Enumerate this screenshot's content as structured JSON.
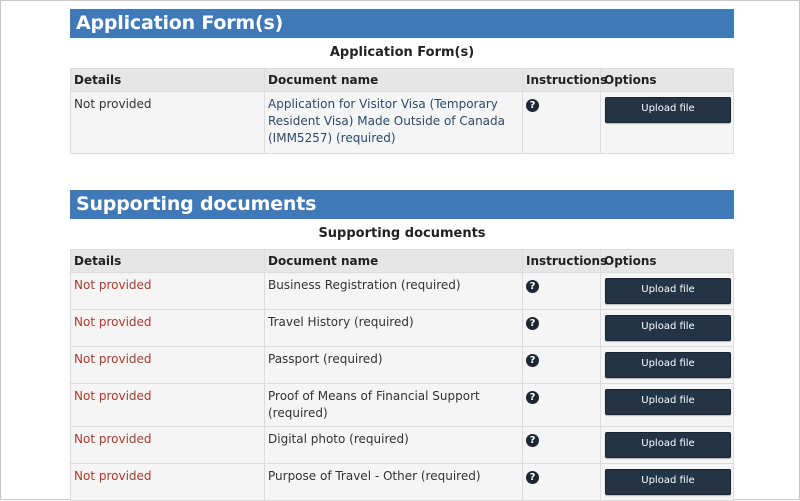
{
  "application_section": {
    "banner_title": "Application Form(s)",
    "caption": "Application Form(s)",
    "headers": {
      "details": "Details",
      "document_name": "Document name",
      "instructions": "Instructions",
      "options": "Options"
    },
    "rows": [
      {
        "details": "Not provided",
        "document_name": "Application for Visitor Visa (Temporary Resident Visa) Made Outside of Canada (IMM5257)  (required)",
        "instructions_icon": "question-circle-icon",
        "button_label": "Upload file"
      }
    ]
  },
  "supporting_section": {
    "banner_title": "Supporting documents",
    "caption": "Supporting documents",
    "headers": {
      "details": "Details",
      "document_name": "Document name",
      "instructions": "Instructions",
      "options": "Options"
    },
    "rows": [
      {
        "details": "Not provided",
        "document_name": "Business Registration  (required)",
        "instructions_icon": "question-circle-icon",
        "button_label": "Upload file"
      },
      {
        "details": "Not provided",
        "document_name": "Travel History  (required)",
        "instructions_icon": "question-circle-icon",
        "button_label": "Upload file"
      },
      {
        "details": "Not provided",
        "document_name": "Passport  (required)",
        "instructions_icon": "question-circle-icon",
        "button_label": "Upload file"
      },
      {
        "details": "Not provided",
        "document_name": "Proof of Means of Financial Support  (required)",
        "instructions_icon": "question-circle-icon",
        "button_label": "Upload file"
      },
      {
        "details": "Not provided",
        "document_name": "Digital photo  (required)",
        "instructions_icon": "question-circle-icon",
        "button_label": "Upload file"
      },
      {
        "details": "Not provided",
        "document_name": "Purpose of Travel - Other  (required)",
        "instructions_icon": "question-circle-icon",
        "button_label": "Upload file"
      }
    ]
  },
  "colors": {
    "banner": "#3f79b8",
    "button": "#243447",
    "not_provided_red": "#a93a2e",
    "document_link": "#2b4a6e",
    "header_bg": "#e6e6e6",
    "row_bg": "#f5f5f5"
  },
  "help_icon_glyph": "?"
}
